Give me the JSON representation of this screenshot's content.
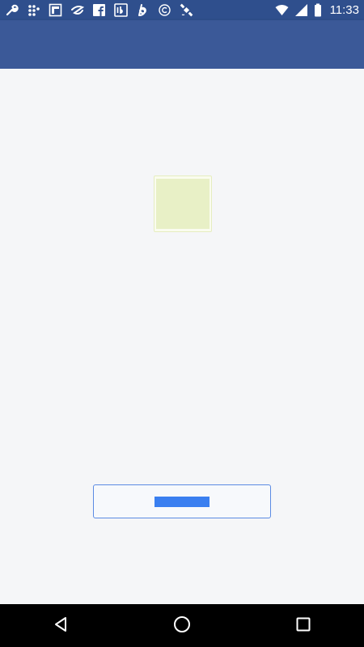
{
  "status_bar": {
    "time": "11:33",
    "left_icons": [
      "wrench-icon",
      "blackberry-icon",
      "flipboard-icon",
      "zedge-icon",
      "facebook-icon",
      "ibibo-icon",
      "bold-b-icon",
      "copyright-icon",
      "satellite-icon"
    ],
    "right_icons": [
      "wifi-icon",
      "signal-icon",
      "battery-icon"
    ]
  },
  "app_bar": {
    "color": "#3b5998"
  },
  "main": {
    "thumbnail": {
      "color": "#e8f0c6"
    },
    "action_button": {
      "label": "",
      "accent": "#3a7ff0"
    }
  },
  "nav_bar": {
    "buttons": [
      "back-icon",
      "home-icon",
      "recents-icon"
    ]
  }
}
